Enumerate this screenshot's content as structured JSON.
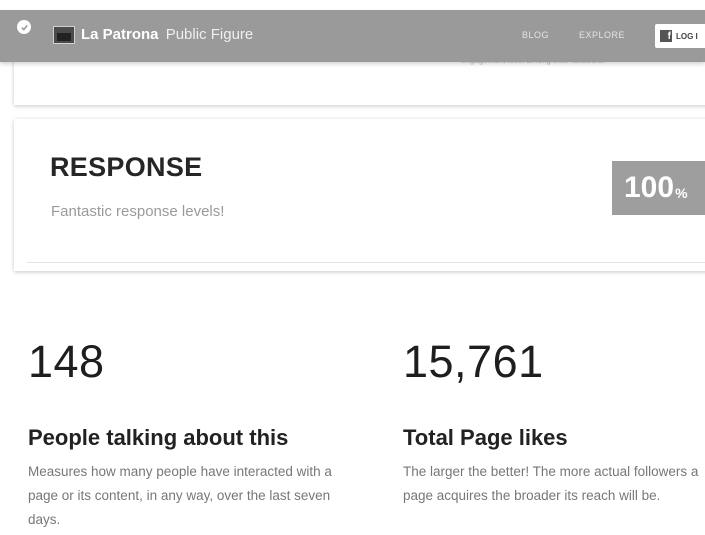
{
  "header": {
    "page_name": "La Patrona",
    "page_type": "Public Figure",
    "nav": {
      "blog": "BLOG",
      "explore": "EXPLORE"
    },
    "login_label": "LOG I",
    "icons": [
      "check-circle-icon",
      "page-thumbnail-icon",
      "facebook-icon"
    ]
  },
  "engagement_card": {
    "cut_text": "engagement level among their followers."
  },
  "response": {
    "title": "RESPONSE",
    "subtitle": "Fantastic response levels!",
    "score_value": "100",
    "score_unit": "%"
  },
  "stats": [
    {
      "number": "148",
      "title": "People talking about this",
      "description": "Measures how many people have interacted with a page or its content, in any way, over the last seven days."
    },
    {
      "number": "15,761",
      "title": "Total Page likes",
      "description": "The larger the better! The more actual followers a page acquires the broader its reach will be."
    }
  ],
  "colors": {
    "header_bg": "#9a9a9a",
    "badge_bg": "#9e9e9e",
    "text_dark": "#222222",
    "text_muted": "#777777"
  }
}
